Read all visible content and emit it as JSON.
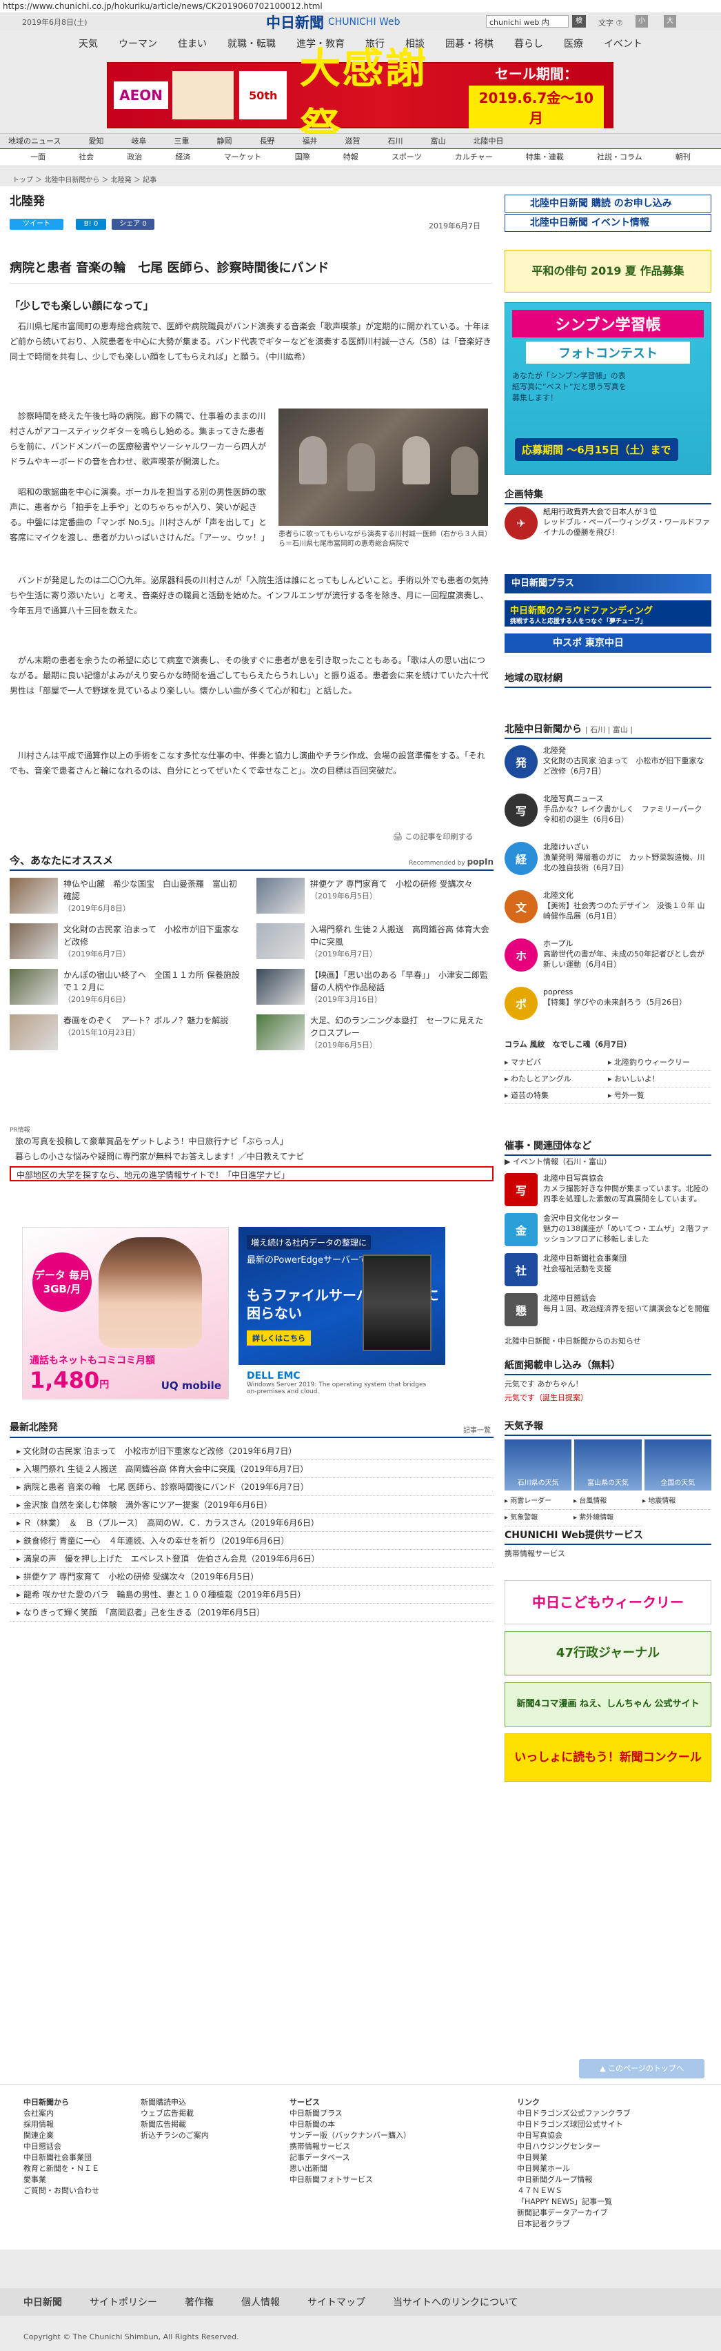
{
  "url": "https://www.chunichi.co.jp/hokuriku/article/news/CK2019060702100012.html",
  "header": {
    "date": "2019年6月8日(土)",
    "logo_jp": "中日新聞",
    "logo_en": "CHUNICHI Web",
    "search_value": "chunichi web 内",
    "search_btn": "検",
    "font_label": "文字 ⑦",
    "font_small": "小",
    "font_big": "大"
  },
  "gnav": [
    "天気",
    "ウーマン",
    "住まい",
    "就職・転職",
    "進学・教育",
    "旅行",
    "相談",
    "囲碁・将棋",
    "暮らし",
    "医療",
    "イベント"
  ],
  "banner": {
    "brand": "AEON",
    "badge": "50th",
    "title": "大感謝祭",
    "sale": "セール期間：",
    "dates": "2019.6.7金〜10月"
  },
  "regnav": [
    "地域のニュース",
    "愛知",
    "岐阜",
    "三重",
    "静岡",
    "長野",
    "福井",
    "滋賀",
    "石川",
    "富山",
    "北陸中日"
  ],
  "catnav": [
    "一面",
    "社会",
    "政治",
    "経済",
    "マーケット",
    "国際",
    "特報",
    "スポーツ",
    "カルチャー",
    "特集・連載",
    "社説・コラム",
    "朝刊"
  ],
  "crumb": "トップ ＞ 北陸中日新聞から ＞ 北陸発 ＞ 記事",
  "section": "北陸発",
  "share": {
    "tweet": "ツイート",
    "hatena": "B! 0",
    "fb": "シェア 0"
  },
  "pubdate": "2019年6月7日",
  "article": {
    "title": "病院と患者 音楽の輪　七尾 医師ら、診察時間後にバンド",
    "lead": "「少しでも楽しい顔になって」",
    "p1": "石川県七尾市富岡町の恵寿総合病院で、医師や病院職員がバンド演奏する音楽会「歌声喫茶」が定期的に開かれている。十年ほど前から続いており、入院患者を中心に大勢が集まる。バンド代表でギターなどを演奏する医師川村誠一さん（58）は「音楽好き同士で時間を共有し、少しでも楽しい顔をしてもらえれば」と願う。（中川紘希）",
    "p2": "診察時間を終えた午後七時の病院。廊下の隅で、仕事着のままの川村さんがアコースティックギターを鳴らし始める。集まってきた患者らを前に、バンドメンバーの医療秘書やソーシャルワーカーら四人がドラムやキーボードの音を合わせ、歌声喫茶が開演した。",
    "p3": "昭和の歌謡曲を中心に演奏。ボーカルを担当する別の男性医師の歌声に、患者から「拍手を上手や」とのちゃちゃが入り、笑いが起きる。中盤には定番曲の「マンボ No.5」。川村さんが「声を出して」と客席にマイクを渡し、患者が力いっぱいさけんだ。「アーッ、ウッ！」",
    "p4": "バンドが発足したのは二〇〇九年。泌尿器科長の川村さんが「入院生活は誰にとってもしんどいこと。手術以外でも患者の気持ちや生活に寄り添いたい」と考え、音楽好きの職員と活動を始めた。インフルエンザが流行する冬を除き、月に一回程度演奏し、今年五月で通算八十三回を数えた。",
    "p5": "がん末期の患者を余うたの希望に応じて病室で演奏し、その後すぐに患者が息を引き取ったこともある。「歌は人の思い出につながる。最期に良い記憶がよみがえり安らかな時間を過ごしてもらえたらうれしい」と振り返る。患者会に来を続けていた六十代男性は「部屋で一人で野球を見ているより楽しい。懐かしい曲が多くて心が和む」と話した。",
    "p6": "川村さんは平成で通算作以上の手術をこなす多忙な仕事の中、伴奏と協力し演曲やチラシ作成、会場の設営準備をする。「それでも、音楽で患者さんと輪になれるのは、自分にとってぜいたくで幸せなこと」。次の目標は百回突破だ。",
    "caption": "患者らに歌ってもらいながら演奏する川村誠一医師（右から３人目）ら＝石川県七尾市富岡町の恵寿総合病院で",
    "print": "この記事を印刷する"
  },
  "reco": {
    "heading": "今、あなたにオススメ",
    "by": "Recommended by",
    "brand": "popIn",
    "items": [
      {
        "title": "神仏や山麓　希少な国宝　白山曼荼羅　富山初確認",
        "date": "（2019年6月8日）"
      },
      {
        "title": "拼便ケア 専門家育て　小松の研修 受講次々",
        "date": "（2019年6月5日）"
      },
      {
        "title": "文化財の古民家 泊まって　小松市が旧下重家など改修",
        "date": "（2019年6月7日）"
      },
      {
        "title": "入場門祭れ 生徒２人搬送　高岡鐵谷高 体育大会中に突風",
        "date": "（2019年6月7日）"
      },
      {
        "title": "かんぽの宿山い終了へ　全国１１カ所 保養施設で１２月に",
        "date": "（2019年6月6日）"
      },
      {
        "title": "【映画】「思い出のある「早春」」　小津安二郎監督の人柄や作品秘話",
        "date": "（2019年3月16日）"
      },
      {
        "title": "春画をのぞく　アート？ポルノ？魅力を解説",
        "date": "（2015年10月23日）"
      },
      {
        "title": "大足、幻のランニング本塁打　セーフに見えたクロスプレー",
        "date": "（2019年6月5日）"
      }
    ]
  },
  "pr": {
    "label": "PR情報",
    "items": [
      "旅の写真を投稿して豪華賞品をゲットしよう！中日旅行ナビ「ぶらっ人」",
      "暮らしの小さな悩みや疑問に専門家が無料でお答えします！／中日教えてナビ",
      "中部地区の大学を探すなら、地元の進学情報サイトで！「中日進学ナビ」"
    ]
  },
  "ad1": {
    "bubble": "データ\n毎月3GB/月",
    "text": "通話もネットもコミコミ月額",
    "price": "1,480",
    "unit": "円",
    "brand": "UQ mobile"
  },
  "ad2": {
    "tag": "増え続ける社内データの整理に",
    "line": "最新のPowerEdgeサーバーで、",
    "main": "もうファイルサーバーの容量に困らない",
    "btn": "詳しくはこちら",
    "dell": "DELL EMC",
    "sub": "Windows Server 2019: The operating system that bridges on-premises and cloud."
  },
  "latest": {
    "heading": "最新北陸発",
    "link": "記事一覧",
    "items": [
      "文化財の古民家 泊まって　小松市が旧下重家など改修（2019年6月7日）",
      "入場門祭れ 生徒２人搬送　高岡鐵谷高 体育大会中に突風（2019年6月7日）",
      "病院と患者 音楽の輪　七尾 医師ら、診察時間後にバンド（2019年6月7日）",
      "金沢旅 自然を楽しむ体験　満外客にツアー提案（2019年6月6日）",
      "Ｒ（林業）　＆　Ｂ（ブルース）　高岡のＷ．Ｃ．カラスさん（2019年6月6日）",
      "鉄食修行 青童に一心　４年連続、入々の幸せを祈り（2019年6月6日）",
      "満泉の声　優を押し上げた　エベレスト登頂　佐伯さん会見（2019年6月6日）",
      "拼便ケア 専門家育て　小松の研修 受講次々（2019年6月5日）",
      "龍希 咲かせた愛のバラ　輪島の男性、妻と１００種植栽（2019年6月5日）",
      "なりきって輝く笑顔　「高岡忍者」己を生きる（2019年6月5日）"
    ]
  },
  "side": {
    "sub": "北陸中日新聞 購読 のお申し込み",
    "event": "北陸中日新聞 イベント情報",
    "haiku": "平和の俳句 2019 夏 作品募集",
    "shinbun_title": "シンブン学習帳",
    "shinbun_sub": "フォトコンテスト",
    "shinbun_desc": "あなたが「シンブン学習帳」の表紙写真に“ベスト”だと思う写真を募集します！",
    "shinbun_period": "応募期間 〜6月15日（土）まで",
    "kikaku": "企画特集",
    "kikaku_item": "紙用行政費界大会で日本人が３位",
    "kikaku_sub": "レッドブル・ペーパーウィングス・ワールドファイナルの優勝を飛び！",
    "premium": "中日新聞プラス",
    "crowd": "中日新聞のクラウドファンディング",
    "crowd_sub": "挑戦する人と応援する人をつなぐ「夢チューブ」",
    "chuspo": "中スポ 東京中日",
    "chiiki": "地域の取材網",
    "from": "北陸中日新聞から",
    "from_tabs": "| 石川 | 富山 |",
    "news": [
      {
        "icon": "発",
        "title": "北陸発",
        "text": "文化財の古民家 泊まって　小松市が旧下重家など改修（6月7日）"
      },
      {
        "icon": "写",
        "title": "北陸写真ニュース",
        "text": "手品かな？レイク書かしく　ファミリーパーク 令和初の誕生（6月6日）"
      },
      {
        "icon": "経",
        "title": "北陸けいざい",
        "text": "漁業発明 薄層着のガに　カット野菜製造機、川北の独自技術（6月7日）"
      },
      {
        "icon": "文",
        "title": "北陸文化",
        "text": "【美術】社会秀つのたデザイン　没後１０年 山崎健作品展（6月1日）"
      },
      {
        "icon": "ホ",
        "title": "ホープル",
        "text": "高齢世代の書が年、未成の50年記者びとし会が新しい運動（6月4日）"
      },
      {
        "icon": "ポ",
        "title": "popress",
        "text": "【特集】学びやの未来創ろう（5月26日）"
      }
    ],
    "column": "コラム 風紋　なでしこ魂（6月7日）",
    "links": [
      "マナビバ",
      "北陸釣りウィークリー",
      "わたしとアングル",
      "おいしいよ！",
      "道芸の特集",
      "号外一覧"
    ],
    "events_head": "催事・関連団体など",
    "events_tab": "イベント情報（石川・富山）",
    "events": [
      {
        "icon": "写",
        "title": "北陸中日写真協会",
        "text": "カメラ撮影好きな仲間が集まっています。北陸の四季を処理した素敵の写真展開をしています。"
      },
      {
        "icon": "金",
        "title": "金沢中日文化センター",
        "text": "魅力の138講座が「めいてつ・エムザ」２階ファッションフロアに移転しました"
      },
      {
        "icon": "社",
        "title": "北陸中日新聞社会事業団",
        "text": "社会福祉活動を支援"
      },
      {
        "icon": "懇",
        "title": "北陸中日懇話会",
        "text": "毎月１回、政治経済界を招いて講演会などを開催"
      }
    ],
    "ev_note": "北陸中日新聞・中日新聞からのお知らせ",
    "keisai": "紙面掲載申し込み（無料）",
    "keisai1": "元気です あかちゃん！",
    "keisai2": "元気です（誕生日提案）",
    "tenki": "天気予報",
    "weather": [
      "石川県の天気",
      "富山県の天気",
      "全国の天気"
    ],
    "wlinks": [
      "雨雲レーダー",
      "台風情報",
      "地震情報",
      "気象警報",
      "紫外線情報"
    ],
    "service": "CHUNICHI Web提供サービス",
    "service_item": "携帯情報サービス",
    "kodomo": "中日こどもウィークリー",
    "gyosei": "47行政ジャーナル",
    "yonkoma": "新聞4コマ漫画 ねえ、しんちゃん 公式サイト",
    "nie": "いっしょに読もう！新聞コンクール"
  },
  "pagetop": "このページのトップへ",
  "footer": {
    "col1": [
      "中日新聞から",
      "会社案内",
      "採用情報",
      "関連企業",
      "中日懇話会",
      "中日新聞社会事業団",
      "教育と新聞を・ＮＩＥ",
      "愛事業",
      "ご質問・お問い合わせ"
    ],
    "col2": [
      "",
      "新聞購読申込",
      "ウェブ広告掲載",
      "新聞広告掲載",
      "折込チラシのご案内"
    ],
    "col3": [
      "サービス",
      "中日新聞プラス",
      "中日新聞の本",
      "サンデー版（バックナンバー購入）",
      "携帯情報サービス",
      "記事データベース",
      "思い出新聞",
      "中日新聞フォトサービス"
    ],
    "col4": [
      "リンク",
      "中日ドラゴンズ公式ファンクラブ",
      "中日ドラゴンズ球団公式サイト",
      "中日写真協会",
      "中日ハウジングセンター",
      "中日興業",
      "中日興業ホール",
      "中日新聞グループ情報",
      "４７ＮＥＷＳ",
      "「HAPPY NEWS」記事一覧",
      "新聞記事データアーカイブ",
      "日本記者クラブ"
    ],
    "bar": [
      "中日新聞",
      "サイトポリシー",
      "著作権",
      "個人情報",
      "サイトマップ",
      "当サイトへのリンクについて"
    ],
    "copy": "Copyright © The Chunichi Shimbun, All Rights Reserved."
  },
  "colors": {
    "brand": "#0a3f8f",
    "accent": "#e50000",
    "sale": "#c7001e"
  }
}
